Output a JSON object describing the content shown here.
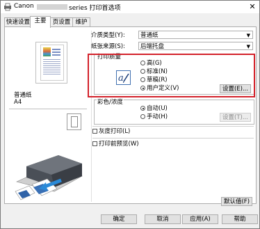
{
  "window": {
    "title_left": "Canon",
    "title_right": "series 打印首选项",
    "close": "✕"
  },
  "tabs": [
    {
      "label": "快速设置"
    },
    {
      "label": "主要"
    },
    {
      "label": "页设置"
    },
    {
      "label": "维护"
    }
  ],
  "left": {
    "media_name": "普通纸",
    "paper_size": "A4"
  },
  "settings": {
    "media_type_label": "介质类型(Y):",
    "media_type_value": "普通纸",
    "paper_source_label": "纸张来源(S):",
    "paper_source_value": "后端托盘"
  },
  "quality": {
    "title": "打印质量",
    "options": [
      "高(G)",
      "标准(N)",
      "草稿(R)",
      "用户定义(V)"
    ],
    "selected_index": 3,
    "set_button": "设置(E)..."
  },
  "color": {
    "title": "彩色/浓度",
    "options": [
      "自动(U)",
      "手动(H)"
    ],
    "selected_index": 0,
    "set_button": "设置(T)..."
  },
  "checks": {
    "grayscale": "灰度打印(L)",
    "preview": "打印前预览(W)"
  },
  "defaults_button": "默认值(F)",
  "bottom": {
    "ok": "确定",
    "cancel": "取消",
    "apply": "应用(A)",
    "help": "帮助"
  }
}
